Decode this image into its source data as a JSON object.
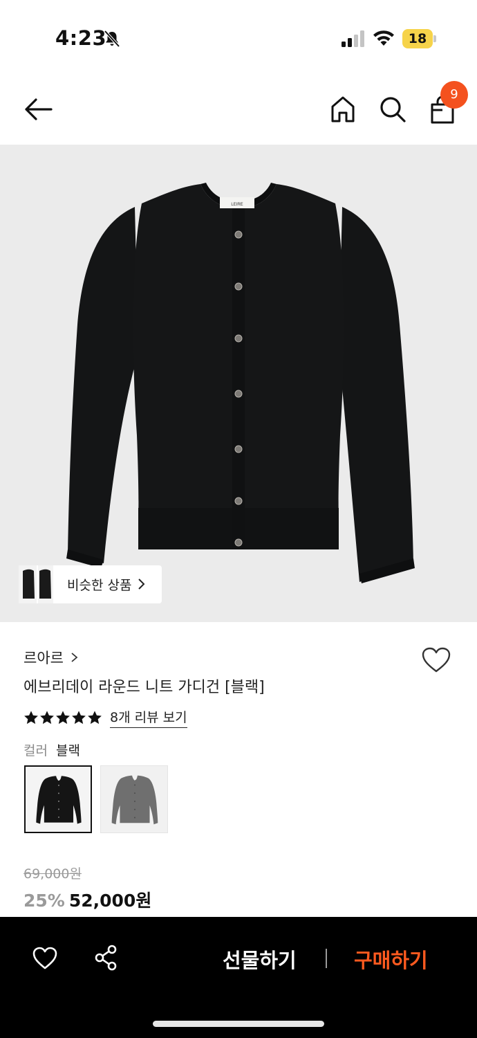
{
  "status_bar": {
    "time": "4:23",
    "battery": "18"
  },
  "nav": {
    "cart_count": "9"
  },
  "hero": {
    "label_text": "LEIRE",
    "similar_label": "비슷한 상품"
  },
  "product": {
    "brand": "르아르",
    "title": "에브리데이 라운드 니트 가디건 [블랙]",
    "rating_stars": 5,
    "review_link": "8개 리뷰 보기",
    "color_label": "컬러",
    "color_value": "블랙",
    "swatches": [
      "black",
      "gray"
    ],
    "original_price": "69,000원",
    "discount": "25%",
    "sale_price": "52,000원"
  },
  "bottom_bar": {
    "gift_label": "선물하기",
    "buy_label": "구매하기"
  },
  "colors": {
    "accent": "#ff5a1f",
    "badge": "#f4511e",
    "battery": "#f6d34a",
    "hero_bg": "#ebebeb"
  },
  "icons": [
    "bell-off-icon",
    "signal-icon",
    "wifi-icon",
    "back-arrow-icon",
    "home-icon",
    "search-icon",
    "shopping-bag-icon",
    "heart-icon",
    "star-icon",
    "share-icon",
    "chevron-right-icon"
  ]
}
